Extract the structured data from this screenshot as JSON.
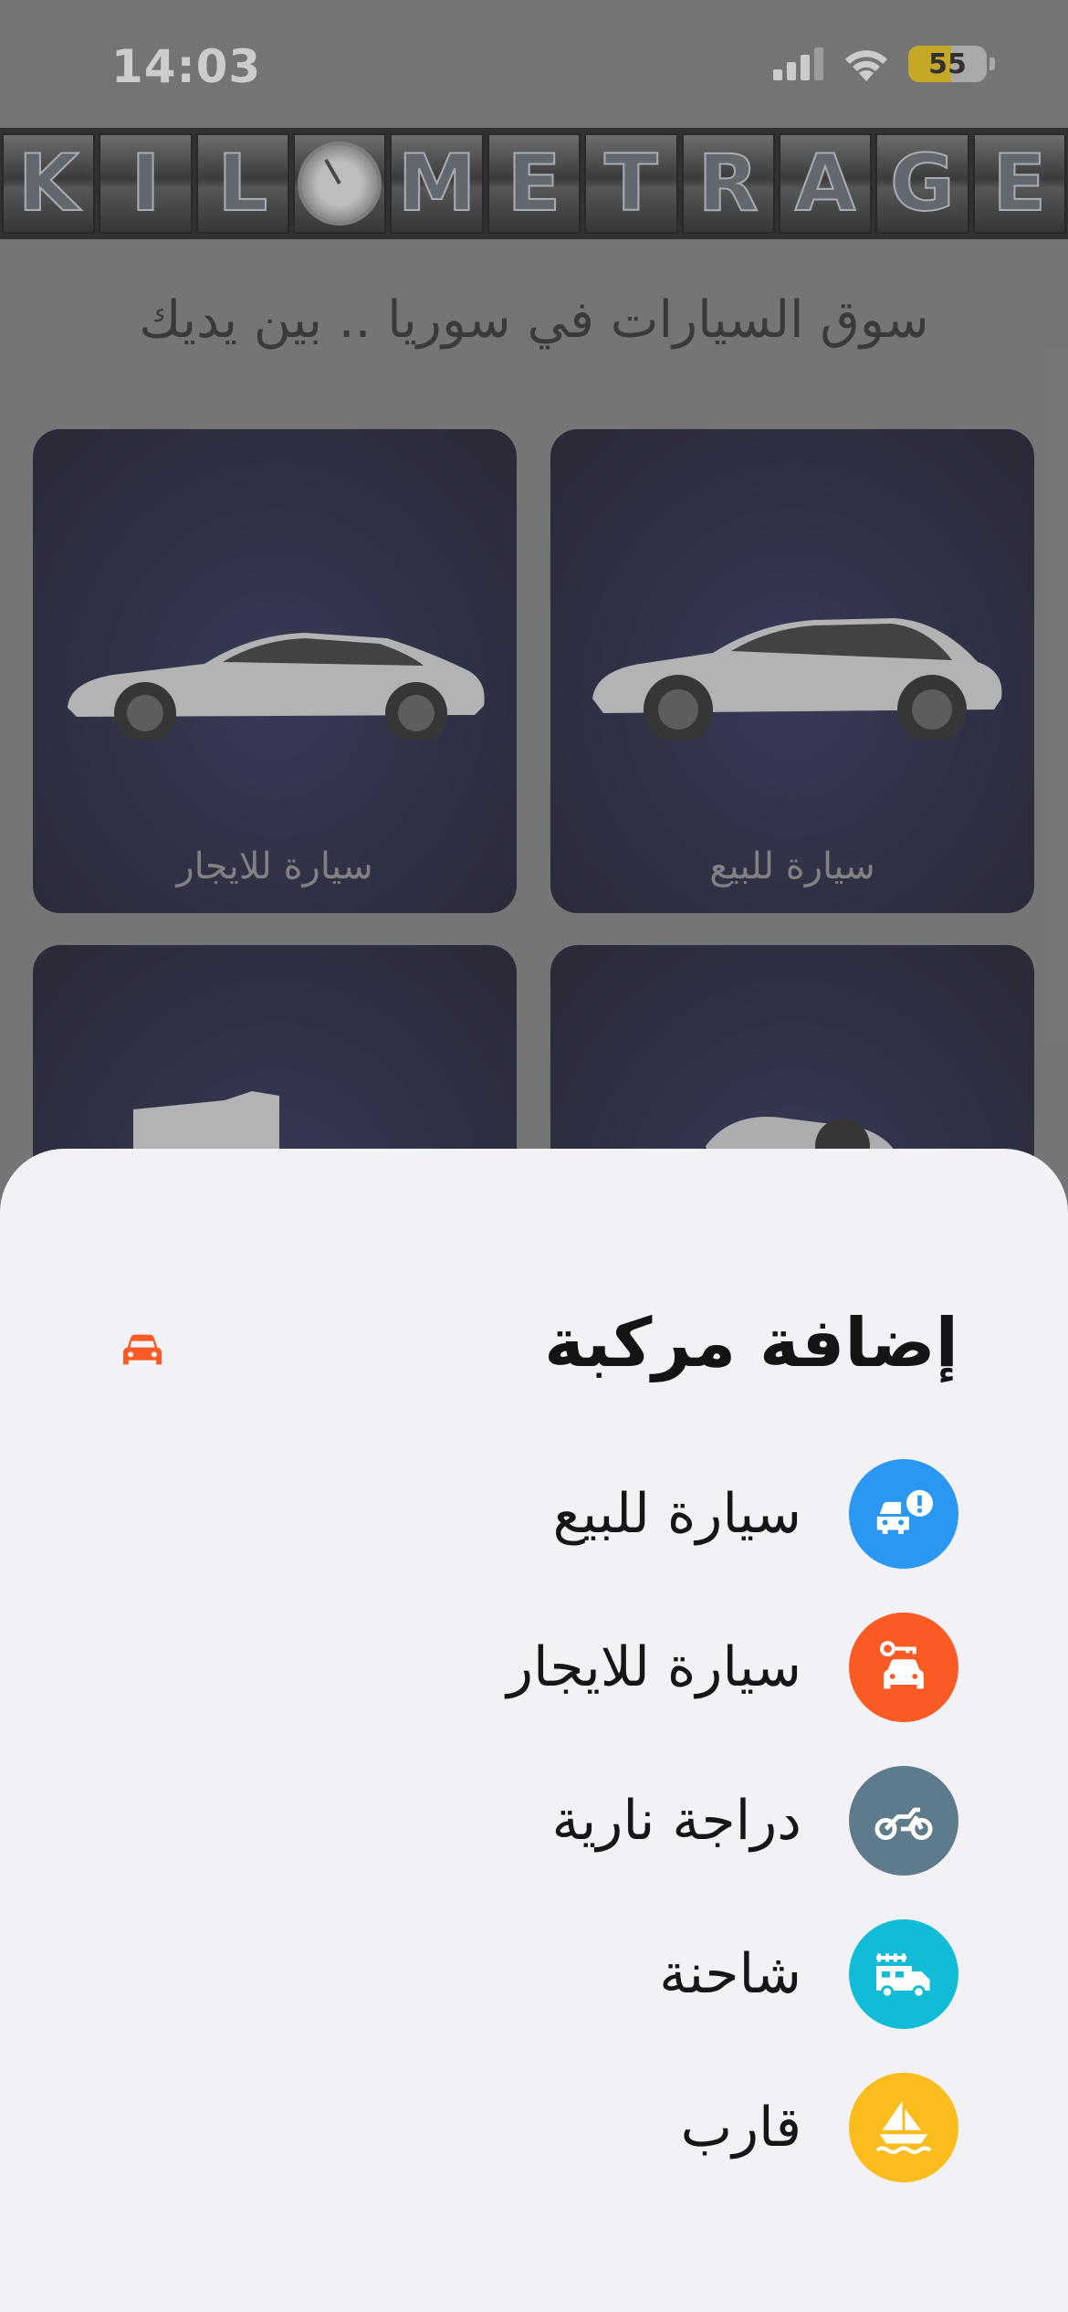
{
  "status_bar": {
    "time": "14:03",
    "battery_percent": "55",
    "battery_level": 0.55
  },
  "header": {
    "logo_text": "KILOMETRAGE"
  },
  "home": {
    "tagline": "سوق السيارات في سوريا .. بين يديك",
    "cards": [
      {
        "label": "سيارة للبيع"
      },
      {
        "label": "سيارة للايجار"
      },
      {
        "label": ""
      },
      {
        "label": ""
      }
    ]
  },
  "sheet": {
    "title": "إضافة مركبة",
    "title_icon": "car-icon",
    "options": [
      {
        "label": "سيارة للبيع",
        "icon": "car-alert-icon",
        "color": "#2a97f0"
      },
      {
        "label": "سيارة للايجار",
        "icon": "car-key-icon",
        "color": "#fa5a24"
      },
      {
        "label": "دراجة نارية",
        "icon": "motorcycle-icon",
        "color": "#5d7b8a"
      },
      {
        "label": "شاحنة",
        "icon": "fire-truck-icon",
        "color": "#12bcd7"
      },
      {
        "label": "قارب",
        "icon": "sailboat-icon",
        "color": "#fbbd1e"
      }
    ],
    "accent": "#fa5a24"
  }
}
